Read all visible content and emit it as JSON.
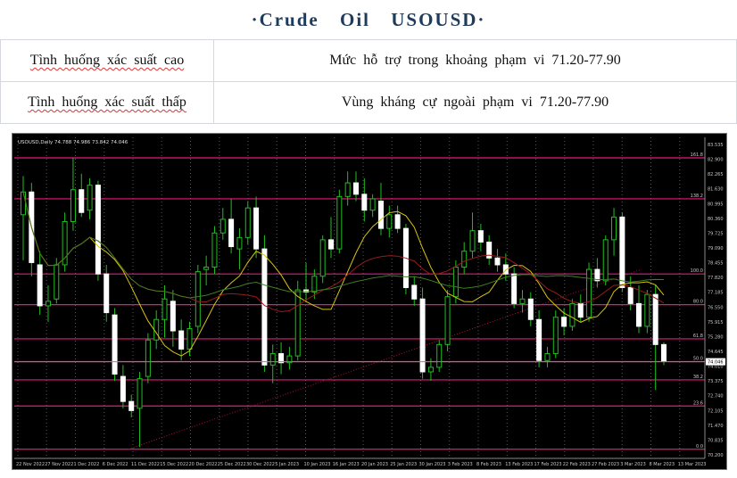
{
  "header": {
    "title": "·Crude  Oil  USOUSD·"
  },
  "table": {
    "rows": [
      {
        "label": "Tình huống xác suất cao",
        "value": "Mức hỗ trợ trong khoảng phạm vi 71.20-77.90"
      },
      {
        "label": "Tình huống xác suất thấp",
        "value": "Vùng kháng cự ngoài phạm vi 71.20-77.90"
      }
    ]
  },
  "chart_data": {
    "type": "candlestick",
    "symbol_header": "USOUSD,Daily  74.788 74.986 73.842 74.046",
    "current_price": 74.046,
    "current_price_label": "74.046",
    "ylim": [
      69.8,
      83.9
    ],
    "y_ticks": [
      "83.535",
      "82.900",
      "82.265",
      "81.630",
      "80.995",
      "80.360",
      "79.725",
      "79.090",
      "78.455",
      "77.820",
      "77.185",
      "76.550",
      "75.915",
      "75.280",
      "74.645",
      "74.010",
      "73.375",
      "72.740",
      "72.105",
      "71.470",
      "70.835",
      "70.200"
    ],
    "x_ticks": [
      "22 Nov 2022",
      "27 Nov 2022",
      "1 Dec 2022",
      "6 Dec 2022",
      "11 Dec 2022",
      "15 Dec 2022",
      "20 Dec 2022",
      "25 Dec 2022",
      "30 Dec 2022",
      "5 Jan 2023",
      "10 Jan 2023",
      "16 Jan 2023",
      "20 Jan 2023",
      "25 Jan 2023",
      "30 Jan 2023",
      "3 Feb 2023",
      "8 Feb 2023",
      "13 Feb 2023",
      "17 Feb 2023",
      "22 Feb 2023",
      "27 Feb 2023",
      "3 Mar 2023",
      "8 Mar 2023",
      "13 Mar 2023"
    ],
    "levels": [
      {
        "value": 83.0,
        "label": "161.8"
      },
      {
        "value": 81.2,
        "label": "138.2"
      },
      {
        "value": 77.9,
        "label": "100.0"
      },
      {
        "value": 76.55,
        "label": "80.0"
      },
      {
        "value": 75.05,
        "label": "61.8"
      },
      {
        "value": 74.05,
        "label": "50.0"
      },
      {
        "value": 73.25,
        "label": "38.2"
      },
      {
        "value": 72.1,
        "label": "23.6"
      },
      {
        "value": 70.2,
        "label": "0.0"
      }
    ],
    "candles": [
      {
        "o": 80.5,
        "h": 82.2,
        "l": 78.5,
        "c": 81.5
      },
      {
        "o": 81.5,
        "h": 81.9,
        "l": 77.8,
        "c": 78.4
      },
      {
        "o": 78.3,
        "h": 78.9,
        "l": 76.1,
        "c": 76.5
      },
      {
        "o": 76.5,
        "h": 77.4,
        "l": 75.8,
        "c": 76.7
      },
      {
        "o": 76.8,
        "h": 78.6,
        "l": 76.6,
        "c": 78.3
      },
      {
        "o": 78.3,
        "h": 80.6,
        "l": 78.0,
        "c": 80.2
      },
      {
        "o": 80.2,
        "h": 83.0,
        "l": 79.8,
        "c": 81.6
      },
      {
        "o": 81.6,
        "h": 82.3,
        "l": 80.4,
        "c": 80.6
      },
      {
        "o": 80.7,
        "h": 82.1,
        "l": 80.3,
        "c": 81.8
      },
      {
        "o": 81.8,
        "h": 82.0,
        "l": 77.6,
        "c": 77.9
      },
      {
        "o": 77.9,
        "h": 78.3,
        "l": 75.8,
        "c": 76.2
      },
      {
        "o": 76.1,
        "h": 76.4,
        "l": 73.2,
        "c": 73.5
      },
      {
        "o": 73.4,
        "h": 73.9,
        "l": 72.0,
        "c": 72.3
      },
      {
        "o": 72.3,
        "h": 72.6,
        "l": 71.6,
        "c": 71.9
      },
      {
        "o": 72.0,
        "h": 73.6,
        "l": 70.3,
        "c": 73.3
      },
      {
        "o": 73.4,
        "h": 75.3,
        "l": 73.1,
        "c": 75.0
      },
      {
        "o": 75.0,
        "h": 76.3,
        "l": 74.6,
        "c": 75.9
      },
      {
        "o": 75.9,
        "h": 77.4,
        "l": 75.1,
        "c": 76.8
      },
      {
        "o": 76.7,
        "h": 77.2,
        "l": 74.7,
        "c": 75.4
      },
      {
        "o": 75.4,
        "h": 75.9,
        "l": 74.1,
        "c": 74.6
      },
      {
        "o": 74.6,
        "h": 75.8,
        "l": 74.3,
        "c": 75.5
      },
      {
        "o": 75.6,
        "h": 78.3,
        "l": 75.3,
        "c": 78.0
      },
      {
        "o": 78.1,
        "h": 78.7,
        "l": 77.4,
        "c": 78.2
      },
      {
        "o": 78.2,
        "h": 80.0,
        "l": 77.9,
        "c": 79.7
      },
      {
        "o": 79.7,
        "h": 80.8,
        "l": 79.4,
        "c": 80.3
      },
      {
        "o": 80.3,
        "h": 81.2,
        "l": 78.8,
        "c": 79.1
      },
      {
        "o": 79.0,
        "h": 79.9,
        "l": 78.1,
        "c": 79.5
      },
      {
        "o": 79.5,
        "h": 81.1,
        "l": 79.2,
        "c": 80.8
      },
      {
        "o": 80.8,
        "h": 81.3,
        "l": 78.6,
        "c": 79.0
      },
      {
        "o": 79.0,
        "h": 79.6,
        "l": 73.6,
        "c": 73.9
      },
      {
        "o": 73.9,
        "h": 74.8,
        "l": 73.1,
        "c": 74.4
      },
      {
        "o": 74.4,
        "h": 74.9,
        "l": 73.5,
        "c": 74.0
      },
      {
        "o": 74.0,
        "h": 74.7,
        "l": 73.7,
        "c": 74.3
      },
      {
        "o": 74.3,
        "h": 77.6,
        "l": 74.1,
        "c": 77.2
      },
      {
        "o": 77.2,
        "h": 78.4,
        "l": 76.7,
        "c": 77.1
      },
      {
        "o": 77.1,
        "h": 78.1,
        "l": 76.8,
        "c": 77.8
      },
      {
        "o": 77.8,
        "h": 79.6,
        "l": 77.5,
        "c": 79.4
      },
      {
        "o": 79.4,
        "h": 80.4,
        "l": 78.6,
        "c": 79.0
      },
      {
        "o": 79.0,
        "h": 81.6,
        "l": 78.8,
        "c": 81.3
      },
      {
        "o": 81.3,
        "h": 82.4,
        "l": 80.9,
        "c": 81.9
      },
      {
        "o": 81.9,
        "h": 82.4,
        "l": 81.1,
        "c": 81.4
      },
      {
        "o": 81.4,
        "h": 82.1,
        "l": 80.2,
        "c": 80.7
      },
      {
        "o": 80.7,
        "h": 81.4,
        "l": 80.4,
        "c": 81.2
      },
      {
        "o": 81.1,
        "h": 81.9,
        "l": 79.6,
        "c": 79.9
      },
      {
        "o": 79.9,
        "h": 80.9,
        "l": 79.5,
        "c": 80.5
      },
      {
        "o": 80.5,
        "h": 80.9,
        "l": 79.7,
        "c": 79.9
      },
      {
        "o": 79.9,
        "h": 80.1,
        "l": 77.0,
        "c": 77.3
      },
      {
        "o": 77.4,
        "h": 77.8,
        "l": 76.5,
        "c": 76.8
      },
      {
        "o": 76.8,
        "h": 77.3,
        "l": 73.3,
        "c": 73.6
      },
      {
        "o": 73.6,
        "h": 74.2,
        "l": 73.2,
        "c": 73.8
      },
      {
        "o": 73.8,
        "h": 75.0,
        "l": 73.6,
        "c": 74.8
      },
      {
        "o": 74.8,
        "h": 77.2,
        "l": 74.5,
        "c": 76.9
      },
      {
        "o": 76.9,
        "h": 78.5,
        "l": 76.6,
        "c": 78.2
      },
      {
        "o": 78.2,
        "h": 79.3,
        "l": 77.9,
        "c": 78.9
      },
      {
        "o": 78.9,
        "h": 80.6,
        "l": 78.6,
        "c": 79.8
      },
      {
        "o": 79.8,
        "h": 80.1,
        "l": 78.9,
        "c": 79.3
      },
      {
        "o": 79.3,
        "h": 79.6,
        "l": 78.3,
        "c": 78.6
      },
      {
        "o": 78.6,
        "h": 79.0,
        "l": 78.0,
        "c": 78.3
      },
      {
        "o": 78.3,
        "h": 78.8,
        "l": 77.6,
        "c": 77.9
      },
      {
        "o": 77.9,
        "h": 78.2,
        "l": 76.4,
        "c": 76.6
      },
      {
        "o": 76.6,
        "h": 77.2,
        "l": 76.2,
        "c": 76.8
      },
      {
        "o": 76.8,
        "h": 77.1,
        "l": 75.6,
        "c": 75.9
      },
      {
        "o": 75.9,
        "h": 76.3,
        "l": 73.8,
        "c": 74.1
      },
      {
        "o": 74.1,
        "h": 74.7,
        "l": 73.8,
        "c": 74.4
      },
      {
        "o": 74.4,
        "h": 76.3,
        "l": 74.2,
        "c": 76.0
      },
      {
        "o": 76.0,
        "h": 76.4,
        "l": 75.2,
        "c": 75.6
      },
      {
        "o": 75.6,
        "h": 76.8,
        "l": 75.4,
        "c": 76.6
      },
      {
        "o": 76.6,
        "h": 77.0,
        "l": 75.8,
        "c": 76.0
      },
      {
        "o": 76.0,
        "h": 78.4,
        "l": 75.8,
        "c": 78.1
      },
      {
        "o": 78.1,
        "h": 78.6,
        "l": 77.3,
        "c": 77.6
      },
      {
        "o": 77.6,
        "h": 79.6,
        "l": 77.4,
        "c": 79.4
      },
      {
        "o": 79.4,
        "h": 80.8,
        "l": 78.7,
        "c": 80.4
      },
      {
        "o": 80.4,
        "h": 80.6,
        "l": 77.1,
        "c": 77.3
      },
      {
        "o": 77.3,
        "h": 77.8,
        "l": 76.3,
        "c": 76.6
      },
      {
        "o": 76.6,
        "h": 77.4,
        "l": 75.3,
        "c": 75.6
      },
      {
        "o": 75.6,
        "h": 77.2,
        "l": 75.3,
        "c": 77.0
      },
      {
        "o": 77.0,
        "h": 77.4,
        "l": 72.8,
        "c": 74.8
      },
      {
        "o": 74.8,
        "h": 74.9,
        "l": 73.9,
        "c": 74.05
      }
    ]
  }
}
